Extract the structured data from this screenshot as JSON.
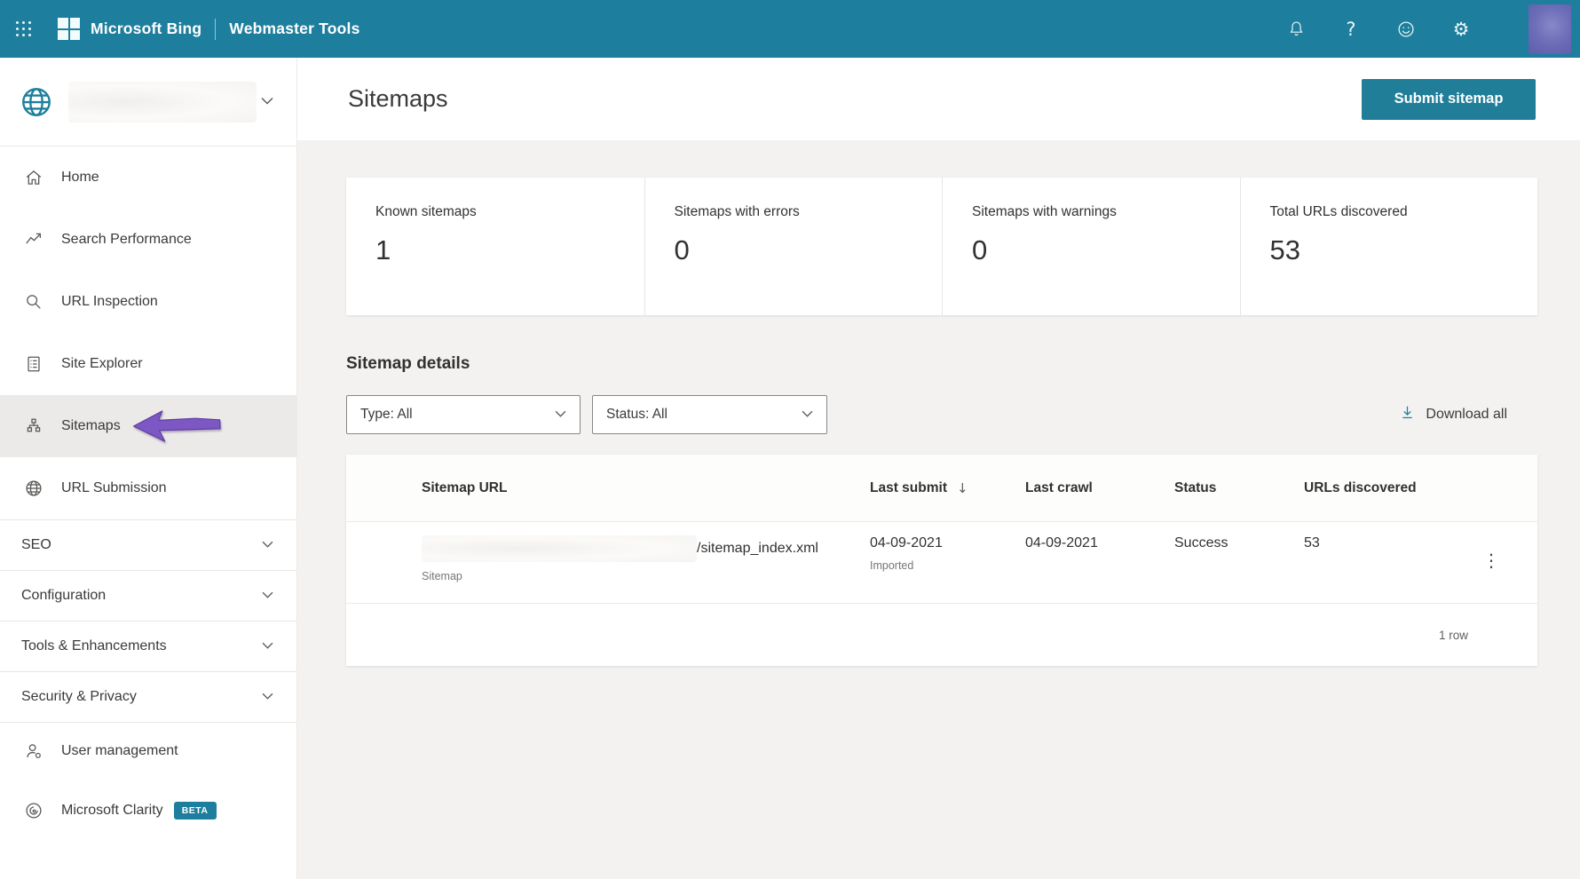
{
  "topbar": {
    "brand": "Microsoft Bing",
    "product": "Webmaster Tools"
  },
  "sidebar": {
    "items": [
      {
        "label": "Home"
      },
      {
        "label": "Search Performance"
      },
      {
        "label": "URL Inspection"
      },
      {
        "label": "Site Explorer"
      },
      {
        "label": "Sitemaps",
        "active": true
      },
      {
        "label": "URL Submission"
      }
    ],
    "groups": [
      {
        "label": "SEO"
      },
      {
        "label": "Configuration"
      },
      {
        "label": "Tools & Enhancements"
      },
      {
        "label": "Security & Privacy"
      }
    ],
    "footer_items": [
      {
        "label": "User management"
      },
      {
        "label": "Microsoft Clarity",
        "badge": "BETA"
      }
    ]
  },
  "page": {
    "title": "Sitemaps",
    "submit_button": "Submit sitemap"
  },
  "stats": [
    {
      "label": "Known sitemaps",
      "value": "1"
    },
    {
      "label": "Sitemaps with errors",
      "value": "0"
    },
    {
      "label": "Sitemaps with warnings",
      "value": "0"
    },
    {
      "label": "Total URLs discovered",
      "value": "53"
    }
  ],
  "details": {
    "heading": "Sitemap details",
    "type_filter": "Type: All",
    "status_filter": "Status: All",
    "download_all": "Download all"
  },
  "table": {
    "columns": [
      "Sitemap URL",
      "Last submit",
      "Last crawl",
      "Status",
      "URLs discovered"
    ],
    "sorted_by": "Last submit",
    "rows": [
      {
        "url_suffix": "/sitemap_index.xml",
        "url_type": "Sitemap",
        "last_submit": "04-09-2021",
        "last_submit_note": "Imported",
        "last_crawl": "04-09-2021",
        "status": "Success",
        "urls_discovered": "53"
      }
    ],
    "footer": "1 row"
  },
  "colors": {
    "header_teal": "#1d7f9d",
    "button_teal": "#217e98",
    "accent_purple": "#7d57c3",
    "page_background": "#f3f2f1"
  }
}
